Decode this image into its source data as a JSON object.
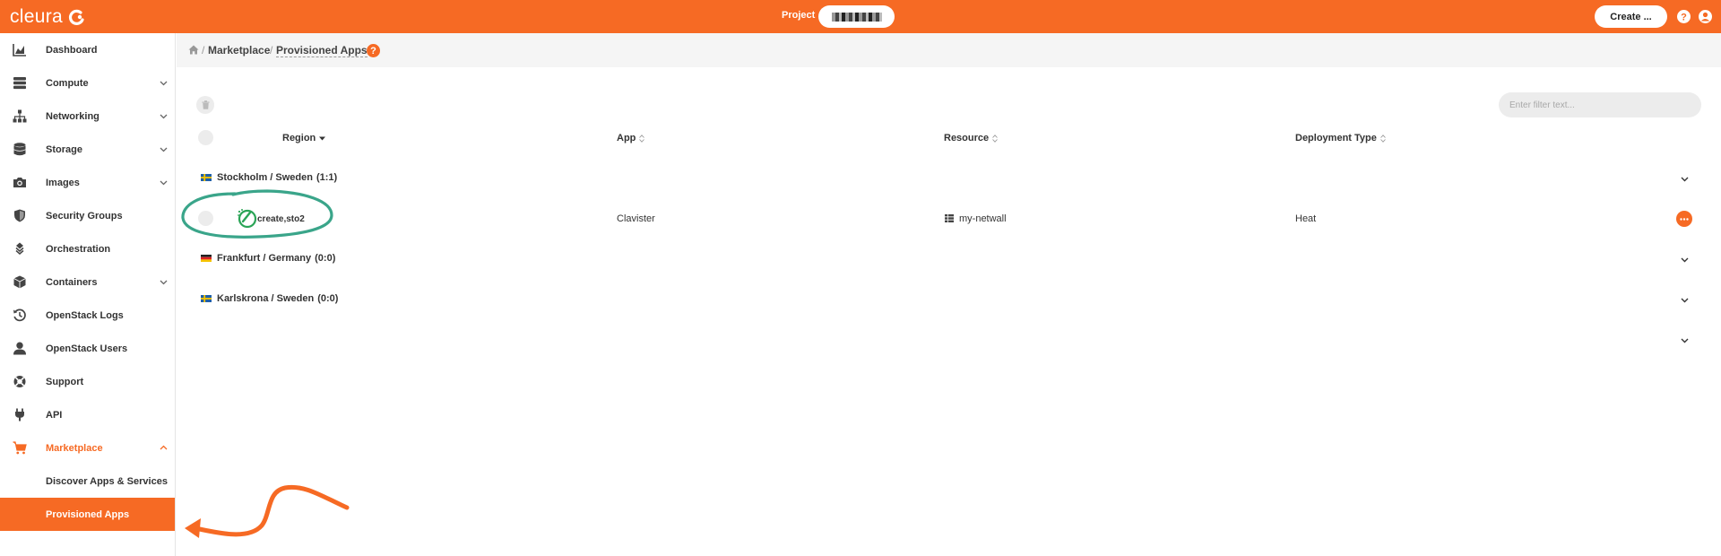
{
  "app": {
    "brand": "cleura",
    "accent": "#f66a24"
  },
  "header": {
    "project_label": "Project",
    "create_label": "Create ...",
    "icons": [
      "help-icon",
      "user-account-icon"
    ]
  },
  "sidebar": {
    "items": [
      {
        "label": "Dashboard",
        "icon": "chart-area-icon"
      },
      {
        "label": "Compute",
        "icon": "server-icon"
      },
      {
        "label": "Networking",
        "icon": "sitemap-icon"
      },
      {
        "label": "Storage",
        "icon": "database-icon"
      },
      {
        "label": "Images",
        "icon": "camera-icon"
      },
      {
        "label": "Security Groups",
        "icon": "shield-icon"
      },
      {
        "label": "Orchestration",
        "icon": "layers-icon"
      },
      {
        "label": "Containers",
        "icon": "cube-icon"
      },
      {
        "label": "OpenStack Logs",
        "icon": "history-icon"
      },
      {
        "label": "OpenStack Users",
        "icon": "user-icon"
      },
      {
        "label": "Support",
        "icon": "lifebuoy-icon"
      },
      {
        "label": "API",
        "icon": "plug-icon"
      },
      {
        "label": "Marketplace",
        "icon": "cart-icon"
      }
    ],
    "submenu": [
      {
        "label": "Discover Apps & Services"
      },
      {
        "label": "Provisioned Apps"
      }
    ]
  },
  "breadcrumb": {
    "items": [
      "Marketplace",
      "Provisioned Apps"
    ],
    "help": "?"
  },
  "toolbar": {
    "filter_placeholder": "Enter filter text..."
  },
  "table": {
    "columns": [
      "Region",
      "App",
      "Resource",
      "Deployment Type"
    ],
    "groups": [
      {
        "label": "Stockholm / Sweden",
        "count": "(1:1)",
        "flag": "sweden"
      },
      {
        "label": "Frankfurt / Germany",
        "count": "(0:0)",
        "flag": "germany"
      },
      {
        "label": "Karlskrona / Sweden",
        "count": "(0:0)",
        "flag": "sweden"
      }
    ],
    "rows": [
      {
        "name": "create,sto2",
        "app": "Clavister",
        "resource": "my-netwall",
        "deployment_type": "Heat"
      }
    ]
  }
}
